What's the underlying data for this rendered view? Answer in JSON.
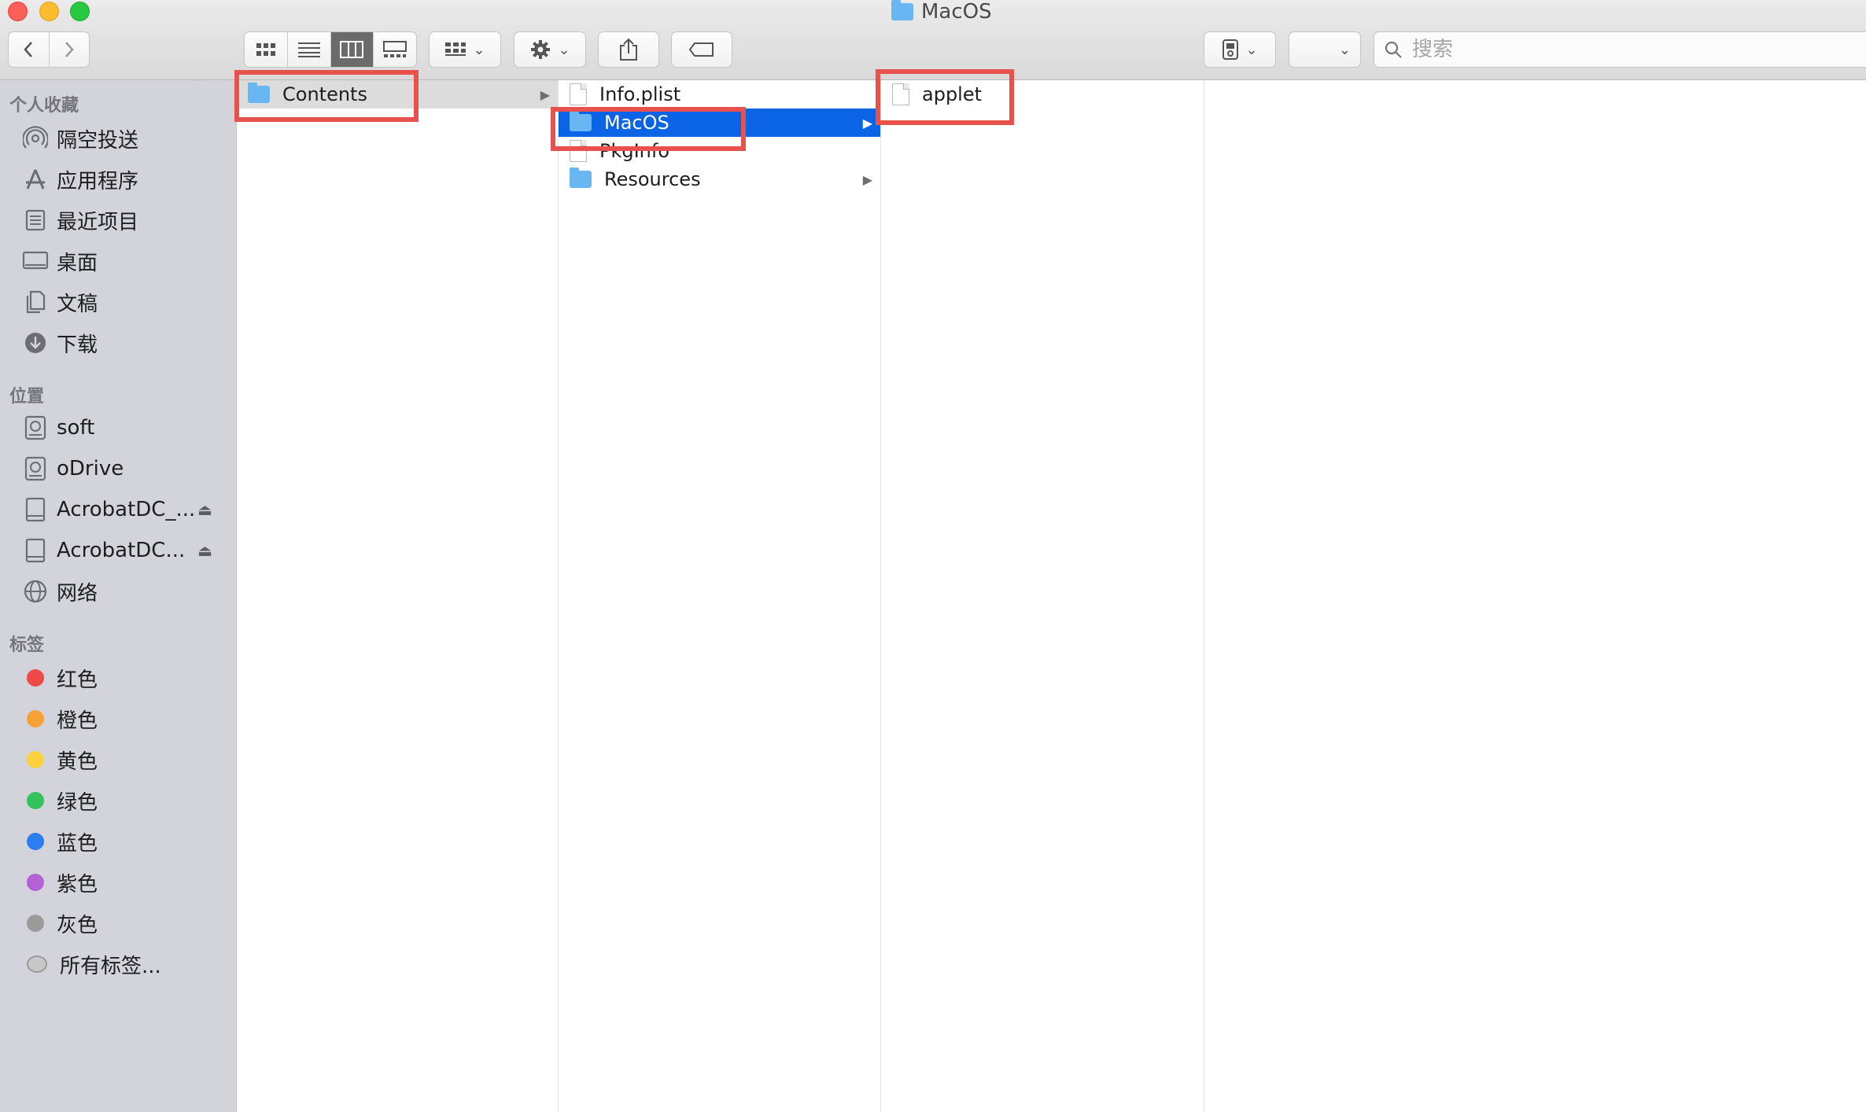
{
  "window": {
    "title": "MacOS"
  },
  "toolbar": {
    "search_placeholder": "搜索"
  },
  "sidebar": {
    "favorites_header": "个人收藏",
    "favorites": [
      {
        "label": "隔空投送",
        "icon": "airdrop-icon"
      },
      {
        "label": "应用程序",
        "icon": "applications-icon"
      },
      {
        "label": "最近项目",
        "icon": "recents-icon"
      },
      {
        "label": "桌面",
        "icon": "desktop-icon"
      },
      {
        "label": "文稿",
        "icon": "documents-icon"
      },
      {
        "label": "下载",
        "icon": "downloads-icon"
      }
    ],
    "locations_header": "位置",
    "locations": [
      {
        "label": "soft",
        "icon": "disk-icon"
      },
      {
        "label": "oDrive",
        "icon": "disk-icon"
      },
      {
        "label": "AcrobatDC_...",
        "icon": "disk-icon",
        "eject": "⏏"
      },
      {
        "label": "AcrobatDC...",
        "icon": "disk-icon",
        "eject": "⏏"
      },
      {
        "label": "网络",
        "icon": "network-icon"
      }
    ],
    "tags_header": "标签",
    "tags": [
      {
        "label": "红色",
        "color": "#ee4b47"
      },
      {
        "label": "橙色",
        "color": "#f6a136"
      },
      {
        "label": "黄色",
        "color": "#fbd140"
      },
      {
        "label": "绿色",
        "color": "#32c45a"
      },
      {
        "label": "蓝色",
        "color": "#2a7ef0"
      },
      {
        "label": "紫色",
        "color": "#b461d6"
      },
      {
        "label": "灰色",
        "color": "#9b9b9b"
      },
      {
        "label": "所有标签...",
        "color": "#c8c8c8"
      }
    ]
  },
  "columns": {
    "col1": [
      {
        "label": "Contents",
        "type": "folder",
        "state": "selected-inactive"
      }
    ],
    "col2": [
      {
        "label": "Info.plist",
        "type": "file"
      },
      {
        "label": "MacOS",
        "type": "folder",
        "state": "selected-active"
      },
      {
        "label": "PkgInfo",
        "type": "file"
      },
      {
        "label": "Resources",
        "type": "folder"
      }
    ],
    "col3": [
      {
        "label": "applet",
        "type": "file"
      }
    ]
  },
  "colors": {
    "selection_blue": "#0b63e5",
    "highlight_box": "#e9514d",
    "sidebar_bg": "#d3d3db"
  }
}
